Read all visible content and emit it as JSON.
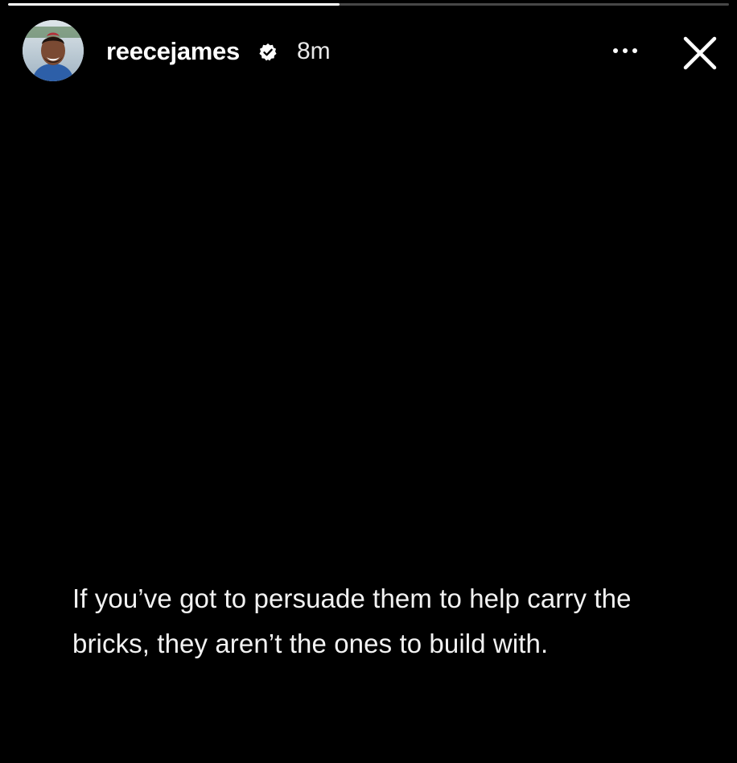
{
  "story": {
    "progress": 0.46,
    "progress_color": "#ffffff",
    "background_color": "#000000"
  },
  "header": {
    "username": "reecejames",
    "verified_icon": "verified-badge-icon",
    "timestamp": "8m",
    "more_icon": "more-horizontal-icon",
    "close_icon": "close-icon"
  },
  "caption": {
    "text": "If you’ve got to persuade them to help carry the bricks, they aren’t the ones to build with."
  }
}
